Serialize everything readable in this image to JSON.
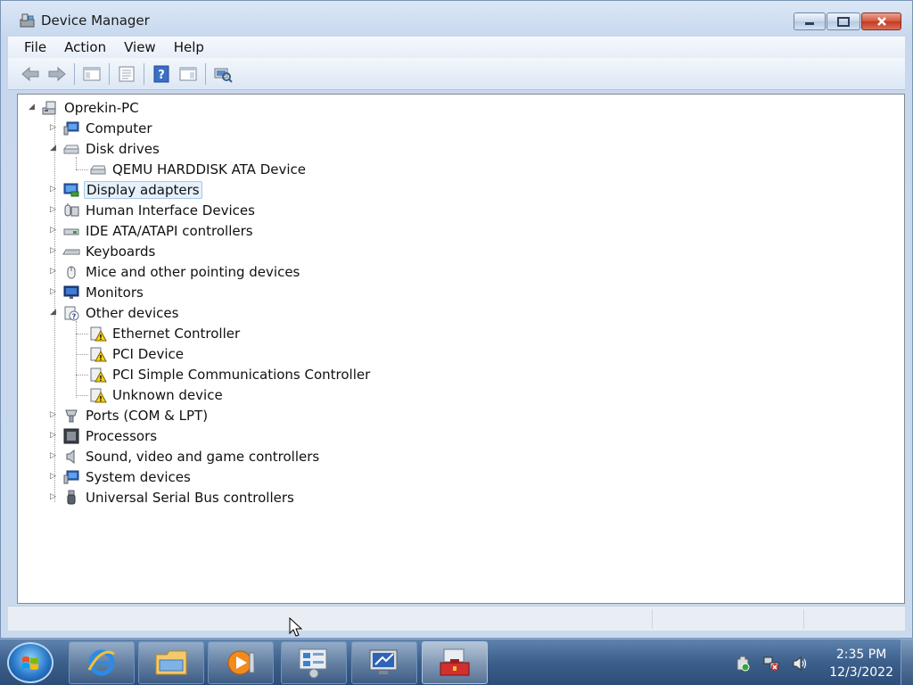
{
  "window": {
    "title": "Device Manager",
    "controls": {
      "minimize": "minimize",
      "maximize": "maximize",
      "close": "close"
    }
  },
  "menubar": {
    "items": [
      "File",
      "Action",
      "View",
      "Help"
    ]
  },
  "toolbar": {
    "buttons": [
      "back-arrow-icon",
      "forward-arrow-icon",
      "show-hide-console-tree-icon",
      "properties-icon",
      "help-icon",
      "action-pane-icon",
      "scan-hardware-icon"
    ]
  },
  "tree": {
    "root": "Oprekin-PC",
    "nodes": [
      {
        "label": "Computer",
        "expanded": false
      },
      {
        "label": "Disk drives",
        "expanded": true,
        "children": [
          "QEMU HARDDISK ATA Device"
        ]
      },
      {
        "label": "Display adapters",
        "expanded": false,
        "selected": true
      },
      {
        "label": "Human Interface Devices",
        "expanded": false
      },
      {
        "label": "IDE ATA/ATAPI controllers",
        "expanded": false
      },
      {
        "label": "Keyboards",
        "expanded": false
      },
      {
        "label": "Mice and other pointing devices",
        "expanded": false
      },
      {
        "label": "Monitors",
        "expanded": false
      },
      {
        "label": "Other devices",
        "expanded": true,
        "children": [
          "Ethernet Controller",
          "PCI Device",
          "PCI Simple Communications Controller",
          "Unknown device"
        ]
      },
      {
        "label": "Ports (COM & LPT)",
        "expanded": false
      },
      {
        "label": "Processors",
        "expanded": false
      },
      {
        "label": "Sound, video and game controllers",
        "expanded": false
      },
      {
        "label": "System devices",
        "expanded": false
      },
      {
        "label": "Universal Serial Bus controllers",
        "expanded": false
      }
    ]
  },
  "taskbar": {
    "apps": [
      "internet-explorer-icon",
      "windows-explorer-icon",
      "media-player-icon",
      "control-panel-icon",
      "remote-desktop-icon",
      "toolbox-icon"
    ],
    "tray": {
      "icons": [
        "action-center-icon",
        "network-icon",
        "volume-icon"
      ],
      "time": "2:35 PM",
      "date": "12/3/2022"
    }
  },
  "colors": {
    "selection": "#e5f0fb",
    "taskbar": "#3c5f8b",
    "window_frame": "#c9daef"
  }
}
